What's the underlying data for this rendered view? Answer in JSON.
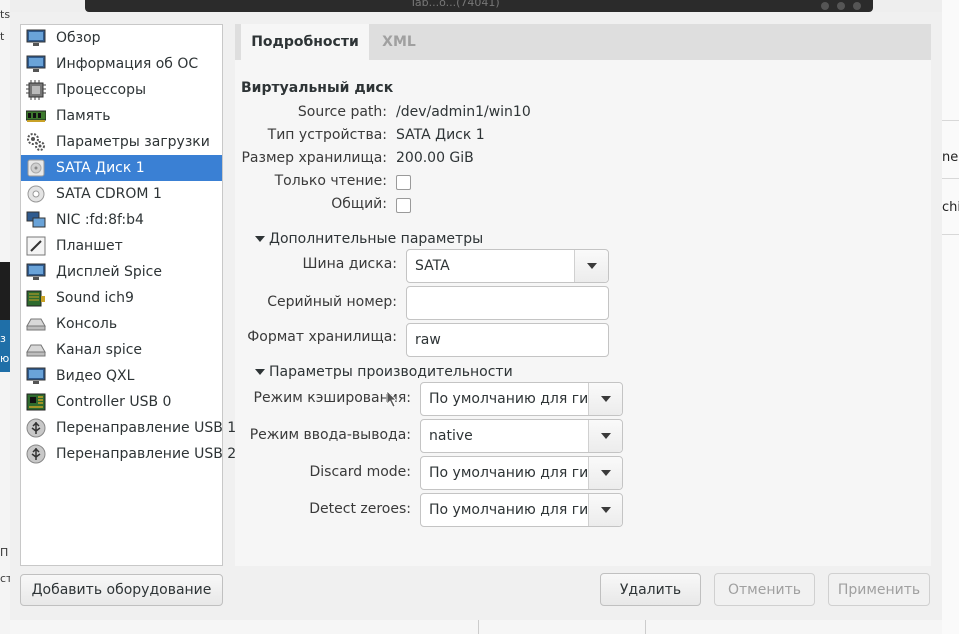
{
  "background": {
    "window_title": "Tab...o...(74041)",
    "left_fragments": [
      "ts",
      "t",
      "з",
      "ю",
      "П",
      "ст"
    ],
    "right_fragments": [
      "ne (",
      "chi"
    ]
  },
  "sidebar": {
    "items": [
      {
        "label": "Обзор",
        "icon": "monitor-icon"
      },
      {
        "label": "Информация об ОС",
        "icon": "monitor-icon"
      },
      {
        "label": "Процессоры",
        "icon": "cpu-icon"
      },
      {
        "label": "Память",
        "icon": "memory-icon"
      },
      {
        "label": "Параметры загрузки",
        "icon": "gears-icon"
      },
      {
        "label": "SATA Диск 1",
        "icon": "disk-icon",
        "selected": true
      },
      {
        "label": "SATA CDROM 1",
        "icon": "cdrom-icon"
      },
      {
        "label": "NIC :fd:8f:b4",
        "icon": "network-icon"
      },
      {
        "label": "Планшет",
        "icon": "tablet-icon"
      },
      {
        "label": "Дисплей Spice",
        "icon": "monitor-icon"
      },
      {
        "label": "Sound ich9",
        "icon": "sound-icon"
      },
      {
        "label": "Консоль",
        "icon": "serial-icon"
      },
      {
        "label": "Канал spice",
        "icon": "serial-icon"
      },
      {
        "label": "Видео QXL",
        "icon": "monitor-icon"
      },
      {
        "label": "Controller USB 0",
        "icon": "controller-icon"
      },
      {
        "label": "Перенаправление USB 1",
        "icon": "usb-icon"
      },
      {
        "label": "Перенаправление USB 2",
        "icon": "usb-icon"
      }
    ],
    "add_button": "Добавить оборудование"
  },
  "tabs": {
    "details": "Подробности",
    "xml": "XML"
  },
  "details": {
    "section_title": "Виртуальный диск",
    "source_path_label": "Source path:",
    "source_path": "/dev/admin1/win10",
    "device_type_label": "Тип устройства:",
    "device_type": "SATA Диск 1",
    "storage_size_label": "Размер хранилища:",
    "storage_size": "200.00 GiB",
    "readonly_label": "Только чтение:",
    "readonly_checked": false,
    "shared_label": "Общий:",
    "shared_checked": false
  },
  "advanced": {
    "title": "Дополнительные параметры",
    "bus_label": "Шина диска:",
    "bus_value": "SATA",
    "serial_label": "Серийный номер:",
    "serial_value": "",
    "format_label": "Формат хранилища:",
    "format_value": "raw"
  },
  "performance": {
    "title": "Параметры производительности",
    "cache_label": "Режим кэширования:",
    "cache_value": "По умолчанию для гип",
    "io_label": "Режим ввода-вывода:",
    "io_value": "native",
    "discard_label": "Discard mode:",
    "discard_value": "По умолчанию для гип",
    "zeroes_label": "Detect zeroes:",
    "zeroes_value": "По умолчанию для гип"
  },
  "buttons": {
    "remove": "Удалить",
    "cancel": "Отменить",
    "apply": "Применить"
  },
  "colors": {
    "selection": "#3a80d4",
    "window_bg": "#f0f0f0"
  }
}
